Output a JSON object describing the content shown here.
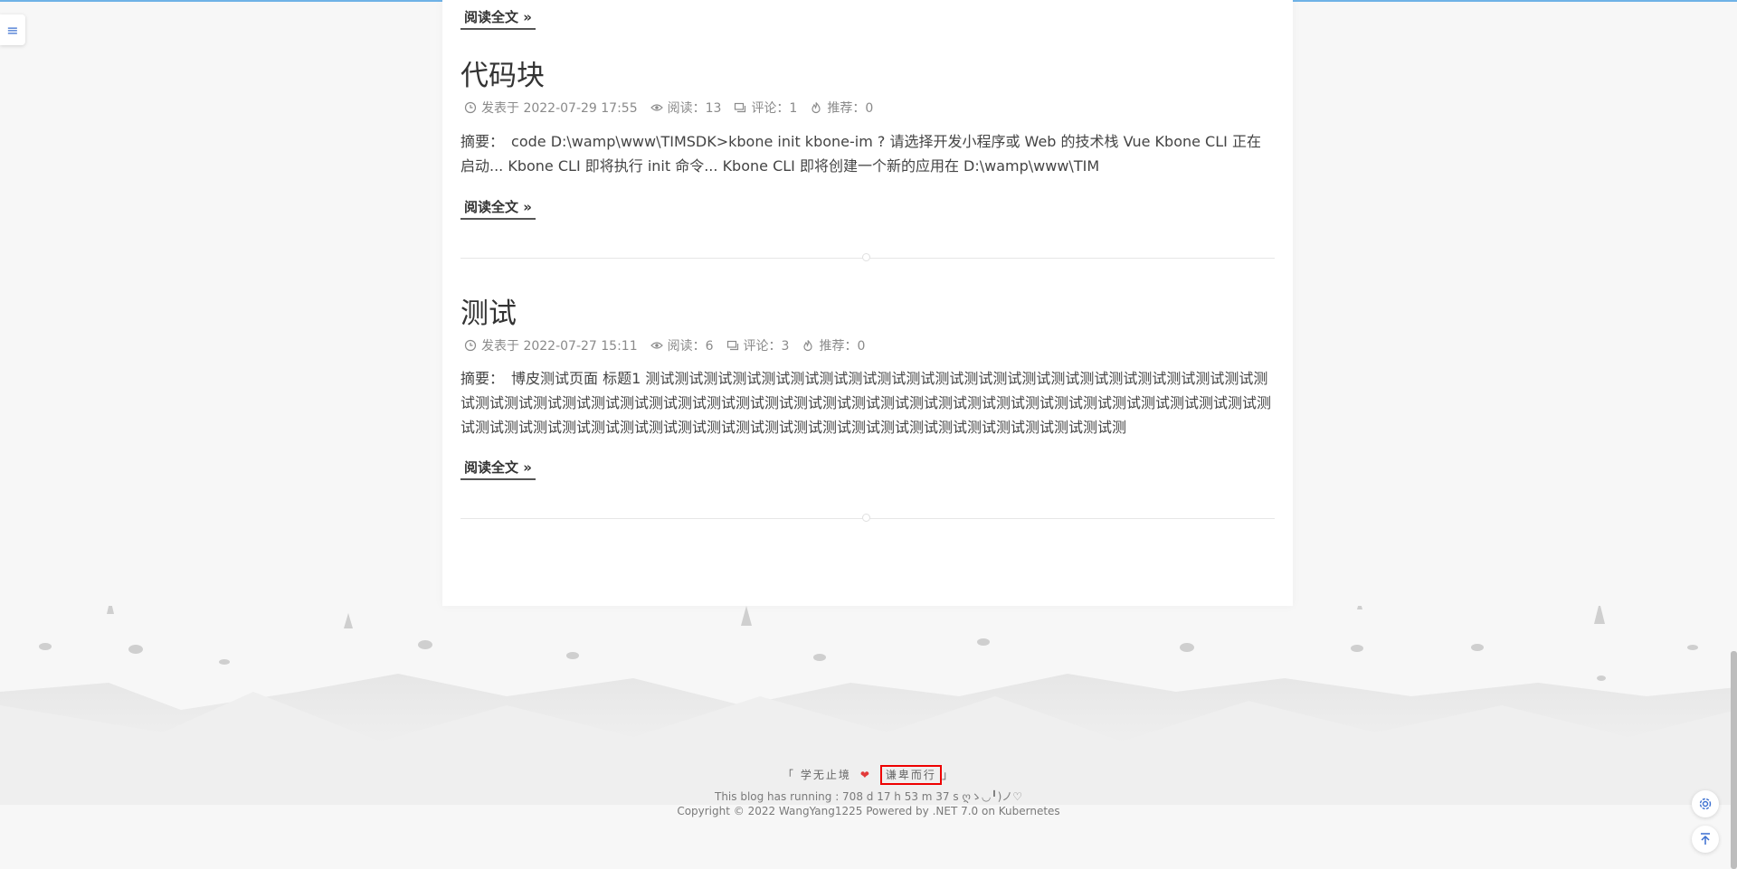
{
  "menu": {
    "icon": "hamburger-icon",
    "glyph": "≡"
  },
  "read_more_label": "阅读全文 »",
  "posts": [
    {
      "title": "代码块",
      "meta": {
        "date_label": "发表于 2022-07-29 17:55",
        "views_label": "阅读：13",
        "comments_label": "评论：1",
        "recommend_label": "推荐：0"
      },
      "summary_label": "摘要：",
      "summary": "code D:\\wamp\\www\\TIMSDK>kbone init kbone-im ? 请选择开发小程序或 Web 的技术栈 Vue Kbone CLI 正在启动... Kbone CLI 即将执行 init 命令... Kbone CLI 即将创建一个新的应用在 D:\\wamp\\www\\TIM"
    },
    {
      "title": "测试",
      "meta": {
        "date_label": "发表于 2022-07-27 15:11",
        "views_label": "阅读：6",
        "comments_label": "评论：3",
        "recommend_label": "推荐：0"
      },
      "summary_label": "摘要：",
      "summary": "博皮测试页面 标题1 测试测试测试测试测试测试测试测试测试测试测试测试测试测试测试测试测试测试测试测试测试测试测试测试测试测试测试测试测试测试测试测试测试测试测试测试测试测试测试测试测试测试测试测试测试测试测试测试测试测试测试测试测试测试测试测试测试测试测试测试测试测试测试测试测试测试测试测试测试测试测试测试测"
    }
  ],
  "footer": {
    "slogan_left": "「 学无止境",
    "slogan_right": "谦卑而行",
    "slogan_end": "」",
    "running": "This blog has running : 708 d 17 h 53 m 37 s ღゝ◡╹)ノ♡",
    "copyright": "Copyright © 2022 WangYang1225 Powered by .NET 7.0 on Kubernetes"
  },
  "side_buttons": {
    "settings_icon": "gear-icon",
    "top_icon": "back-to-top-icon"
  },
  "colors": {
    "accent": "#3b6fd0",
    "top_bar": "#6fb2e6",
    "heart": "#e23a3a",
    "highlight_box": "#ee0000"
  }
}
